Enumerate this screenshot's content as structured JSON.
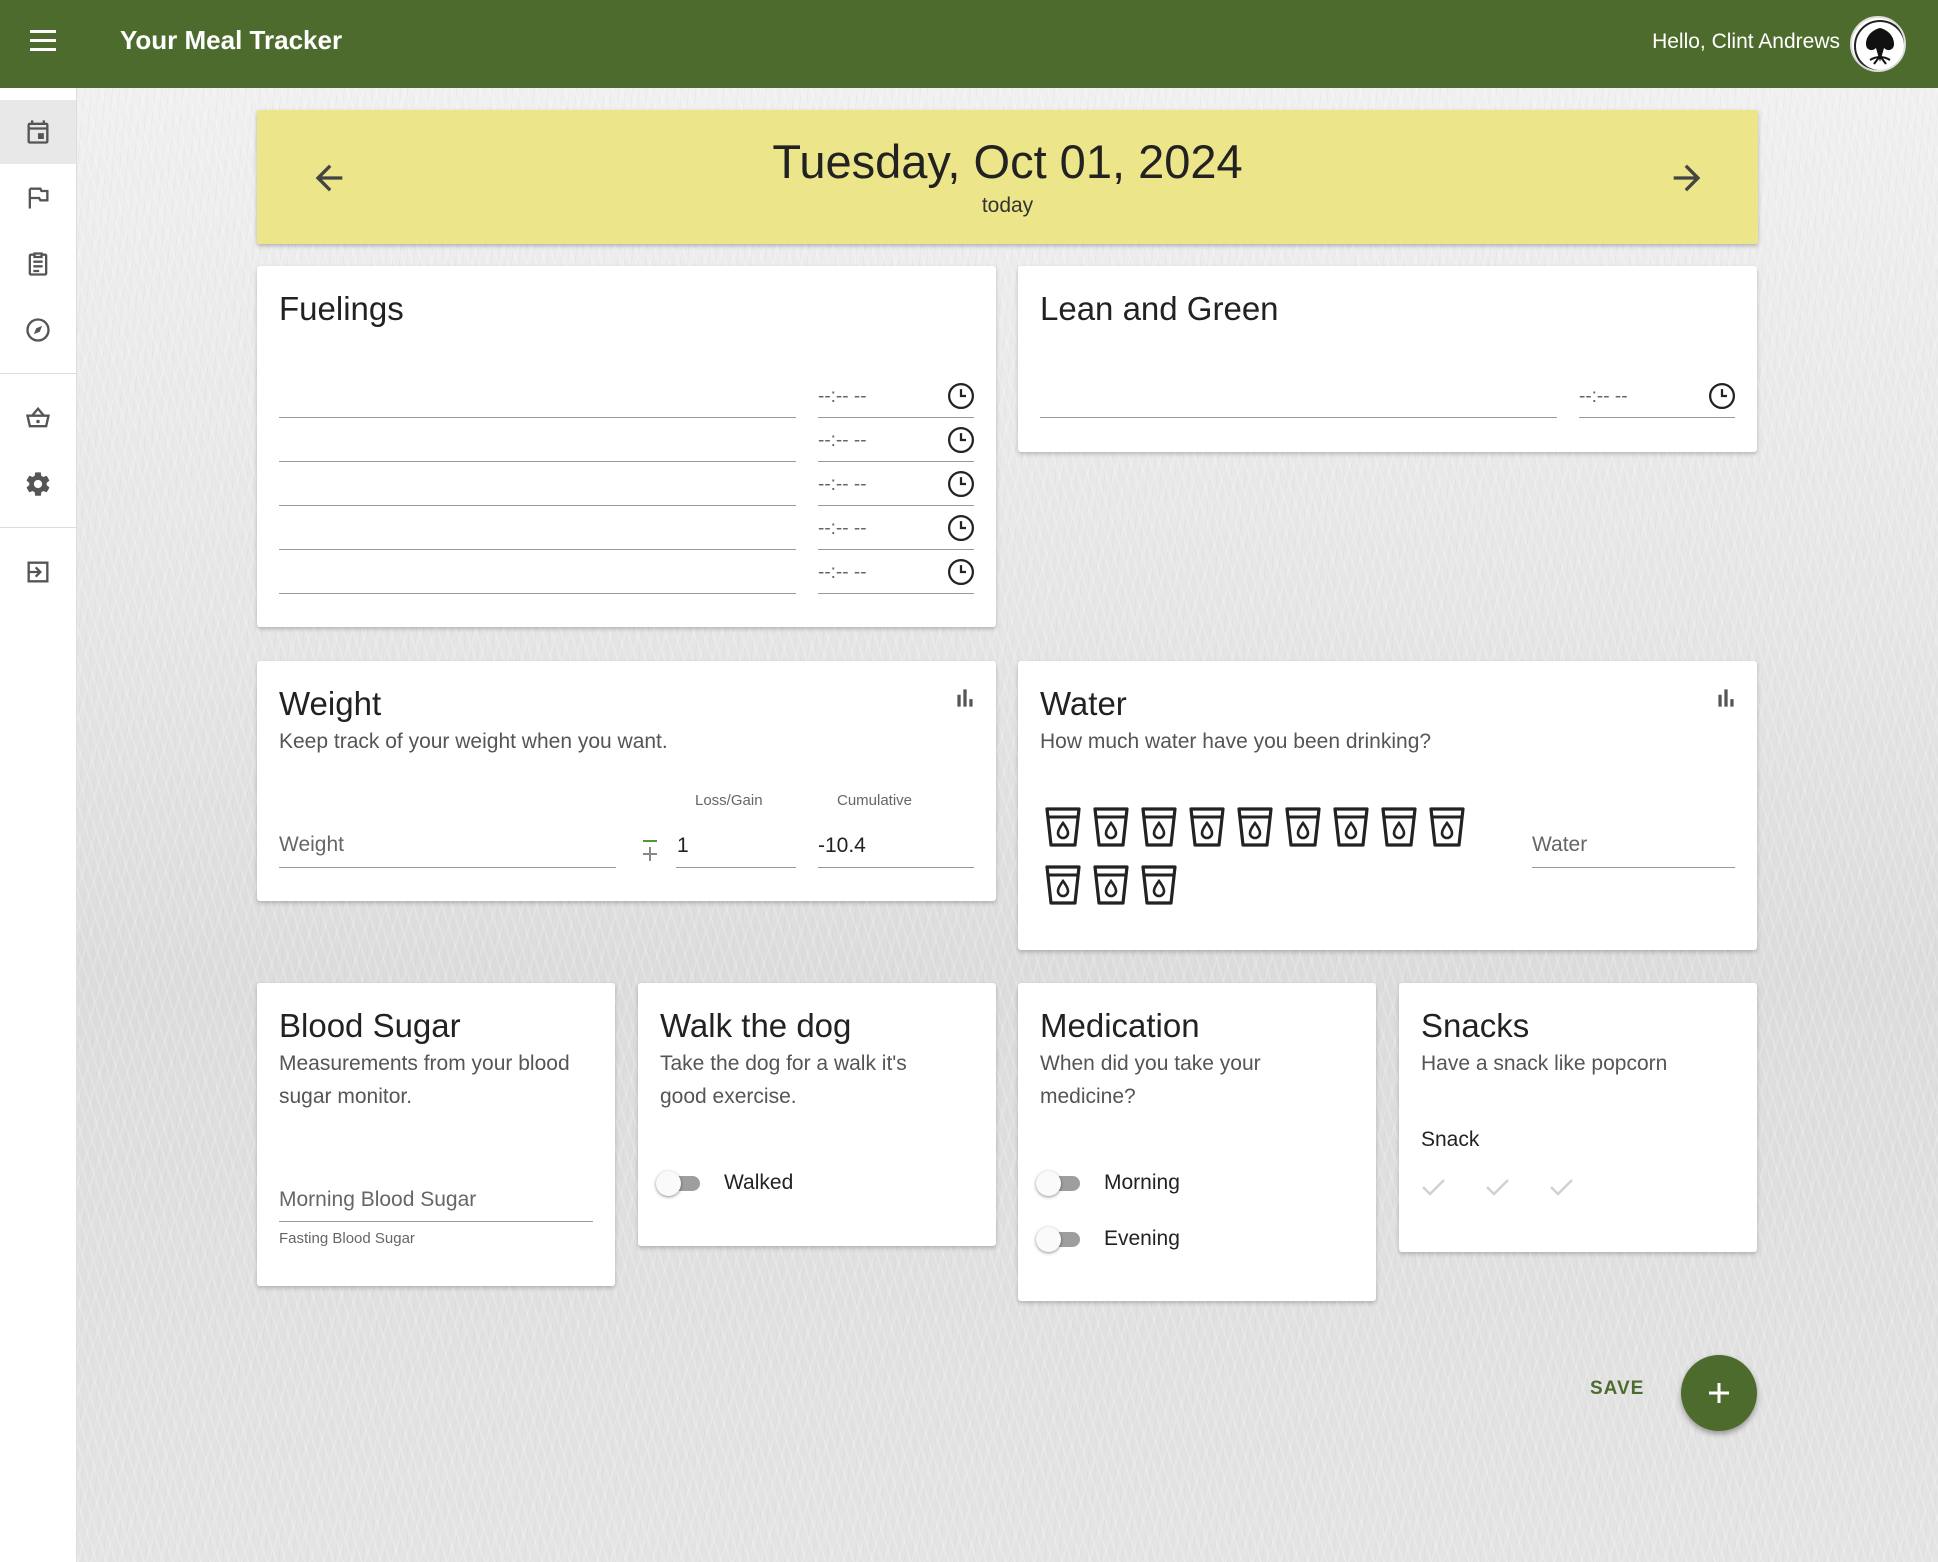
{
  "app": {
    "title": "Your Meal Tracker",
    "greeting": "Hello, Clint Andrews",
    "brand_color": "#4e6b2e"
  },
  "nav": {
    "items": [
      {
        "icon": "calendar-icon",
        "active": true
      },
      {
        "icon": "flag-icon",
        "active": false
      },
      {
        "icon": "clipboard-icon",
        "active": false
      },
      {
        "icon": "compass-icon",
        "active": false
      },
      {
        "icon": "basket-icon",
        "active": false
      },
      {
        "icon": "gear-icon",
        "active": false
      },
      {
        "icon": "logout-icon",
        "active": false
      }
    ]
  },
  "date_header": {
    "date": "Tuesday, Oct 01, 2024",
    "relative": "today",
    "color": "#ede58a"
  },
  "fuelings": {
    "title": "Fuelings",
    "rows": [
      {
        "time": "--:-- --"
      },
      {
        "time": "--:-- --"
      },
      {
        "time": "--:-- --"
      },
      {
        "time": "--:-- --"
      },
      {
        "time": "--:-- --"
      }
    ]
  },
  "lean_green": {
    "title": "Lean and Green",
    "time": "--:-- --"
  },
  "weight": {
    "title": "Weight",
    "subtitle": "Keep track of your weight when you want.",
    "weight_placeholder": "Weight",
    "loss_gain_label": "Loss/Gain",
    "loss_gain_value": "1",
    "cumulative_label": "Cumulative",
    "cumulative_value": "-10.4"
  },
  "water": {
    "title": "Water",
    "subtitle": "How much water have you been drinking?",
    "cup_count": 12,
    "water_placeholder": "Water"
  },
  "blood_sugar": {
    "title": "Blood Sugar",
    "subtitle_line1": "Measurements from your blood",
    "subtitle_line2": "sugar monitor.",
    "field_placeholder": "Morning Blood Sugar",
    "helper": "Fasting Blood Sugar"
  },
  "walk_dog": {
    "title": "Walk the dog",
    "subtitle_line1": "Take the dog for a walk it's",
    "subtitle_line2": "good exercise.",
    "toggle_label": "Walked",
    "toggle_on": false
  },
  "medication": {
    "title": "Medication",
    "subtitle_line1": "When did you take your",
    "subtitle_line2": "medicine?",
    "morning_label": "Morning",
    "evening_label": "Evening"
  },
  "snacks": {
    "title": "Snacks",
    "subtitle": "Have a snack like popcorn",
    "label": "Snack",
    "checks": 3
  },
  "actions": {
    "save_label": "SAVE"
  }
}
